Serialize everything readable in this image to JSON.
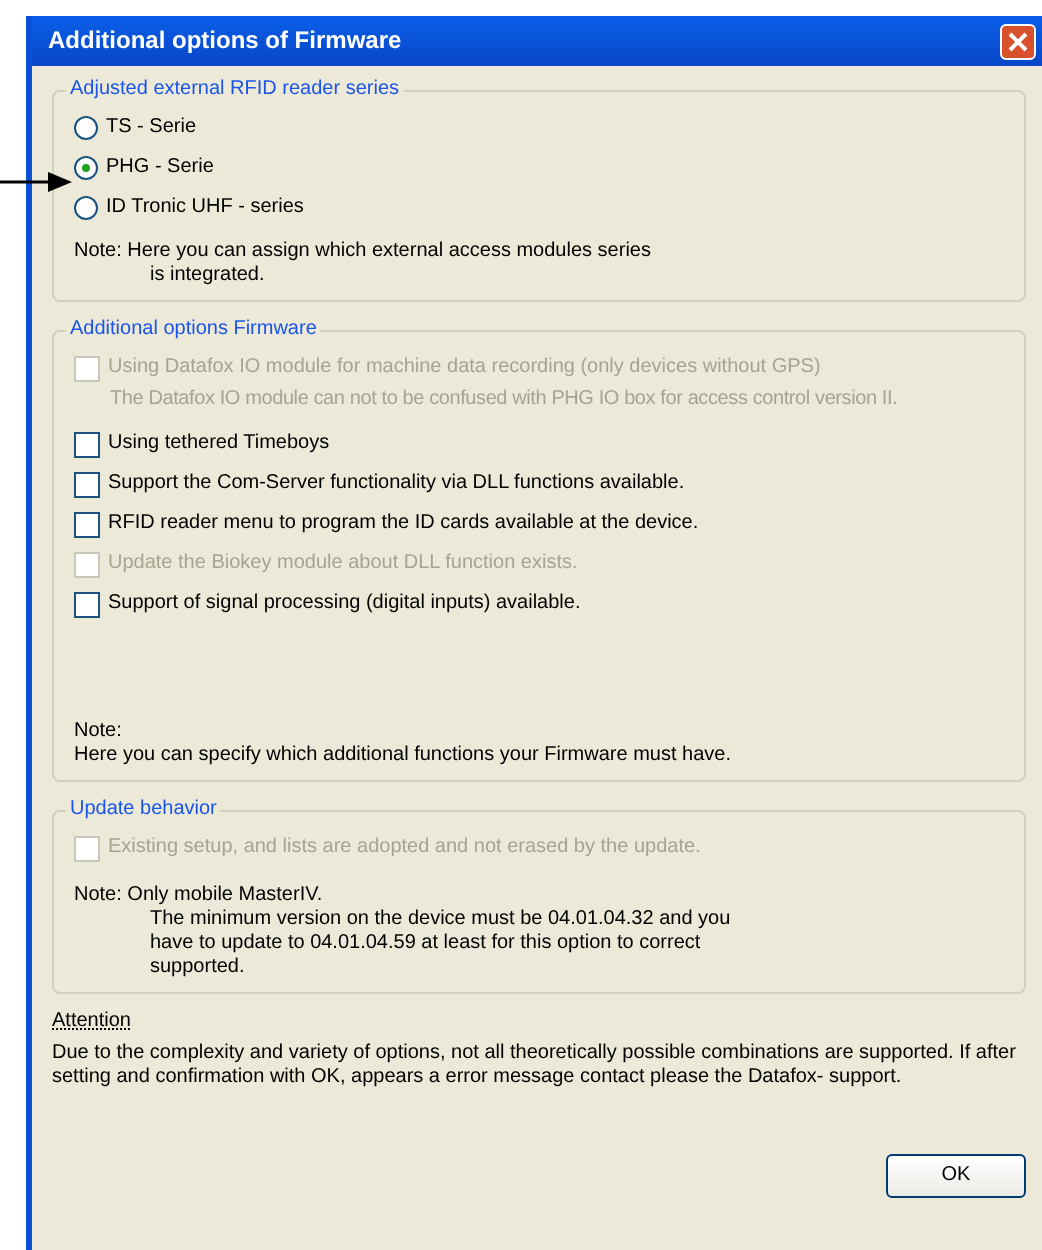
{
  "window": {
    "title": "Additional options of Firmware"
  },
  "reader_series": {
    "title": "Adjusted external RFID reader series",
    "options": [
      {
        "label": "TS - Serie",
        "selected": false
      },
      {
        "label": "PHG - Serie",
        "selected": true
      },
      {
        "label": "ID Tronic UHF - series",
        "selected": false
      }
    ],
    "note": [
      {
        "text": "Note: Here you can assign which external access modules series",
        "indented": false
      },
      {
        "text": "is integrated.",
        "indented": true
      }
    ]
  },
  "firmware_options": {
    "title": "Additional options Firmware",
    "options": [
      {
        "label": "Using Datafox IO module for machine data recording (only devices without GPS)",
        "detail": "The Datafox IO module can not to be confused with PHG IO box for access control version II.",
        "checked": false,
        "disabled": true
      },
      {
        "label": "Using tethered Timeboys",
        "checked": false,
        "disabled": false
      },
      {
        "label": "Support the Com-Server functionality via DLL functions available.",
        "checked": false,
        "disabled": false
      },
      {
        "label": "RFID reader menu to program the ID cards available at the device.",
        "checked": false,
        "disabled": false
      },
      {
        "label": "Update the Biokey module about DLL function exists.",
        "checked": false,
        "disabled": true
      },
      {
        "label": "Support of signal processing (digital inputs) available.",
        "checked": false,
        "disabled": false
      }
    ],
    "note": [
      {
        "text": "Note:",
        "indented": false
      },
      {
        "text": "Here you can specify which additional functions your Firmware must have.",
        "indented": false
      }
    ]
  },
  "update_behavior": {
    "title": "Update behavior",
    "options": [
      {
        "label": "Existing setup, and lists are adopted and not erased by the update.",
        "checked": false,
        "disabled": true
      }
    ],
    "note": [
      {
        "text": "Note: Only mobile MasterIV.",
        "indented": false
      },
      {
        "text": "The minimum version on the device must be 04.01.04.32 and you",
        "indented": true
      },
      {
        "text": "have to update to 04.01.04.59 at least for this option to correct",
        "indented": true
      },
      {
        "text": "supported.",
        "indented": true
      }
    ]
  },
  "attention": {
    "title": "Attention",
    "text": "Due to the complexity and variety of options, not all theoretically possible combinations are supported. If after setting and confirmation with OK, appears a error message contact please the Datafox- support."
  },
  "buttons": [
    {
      "label": "OK"
    }
  ]
}
